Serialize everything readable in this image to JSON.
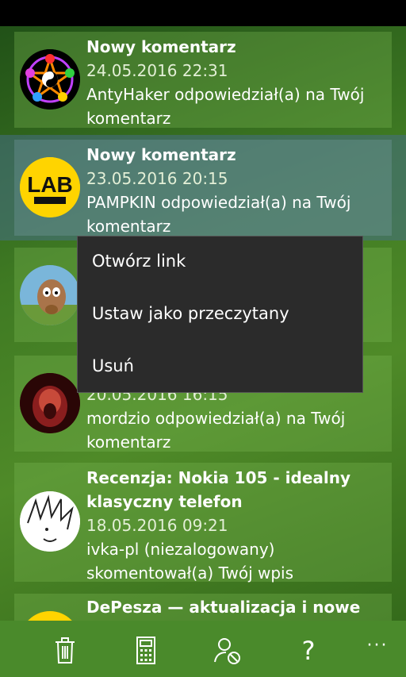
{
  "notifications": [
    {
      "title": "Nowy komentarz",
      "date": "24.05.2016 22:31",
      "line1": "AntyHaker odpowiedział(a) na Twój",
      "line2": "komentarz",
      "avatar": "pentagram-avatar"
    },
    {
      "title": "Nowy komentarz",
      "date": "23.05.2016 20:15",
      "line1": "PAMPKIN odpowiedział(a) na Twój",
      "line2": "komentarz",
      "avatar": "lab-avatar",
      "avatar_text": "LAB"
    },
    {
      "title": "",
      "date": "",
      "line1": "",
      "line2": "",
      "avatar": "squirrel-avatar"
    },
    {
      "title": "",
      "date": "20.05.2016 16:15",
      "line1": "mordzio odpowiedział(a) na Twój",
      "line2": "komentarz",
      "avatar": "monster-avatar"
    },
    {
      "title": "Recenzja: Nokia 105 - idealny",
      "title2": "klasyczny telefon",
      "date": "18.05.2016 09:21",
      "line1": "ivka-pl (niezalogowany)",
      "line2": "skomentował(a) Twój wpis",
      "avatar": "sketch-avatar"
    },
    {
      "title": "DePesza — aktualizacja i nowe",
      "avatar": "yellow-avatar"
    }
  ],
  "context_menu": {
    "items": [
      "Otwórz link",
      "Ustaw jako przeczytany",
      "Usuń"
    ]
  },
  "app_bar": {
    "buttons": [
      "trash-icon",
      "calculator-icon",
      "user-block-icon",
      "help-icon",
      "more-icon"
    ],
    "help_glyph": "?",
    "more_glyph": "···"
  },
  "colors": {
    "card_bg": "#5f9a3e",
    "selected_bg": "#466e87",
    "menu_bg": "#2b2b2b",
    "appbar_bg": "#4a8a2b"
  }
}
